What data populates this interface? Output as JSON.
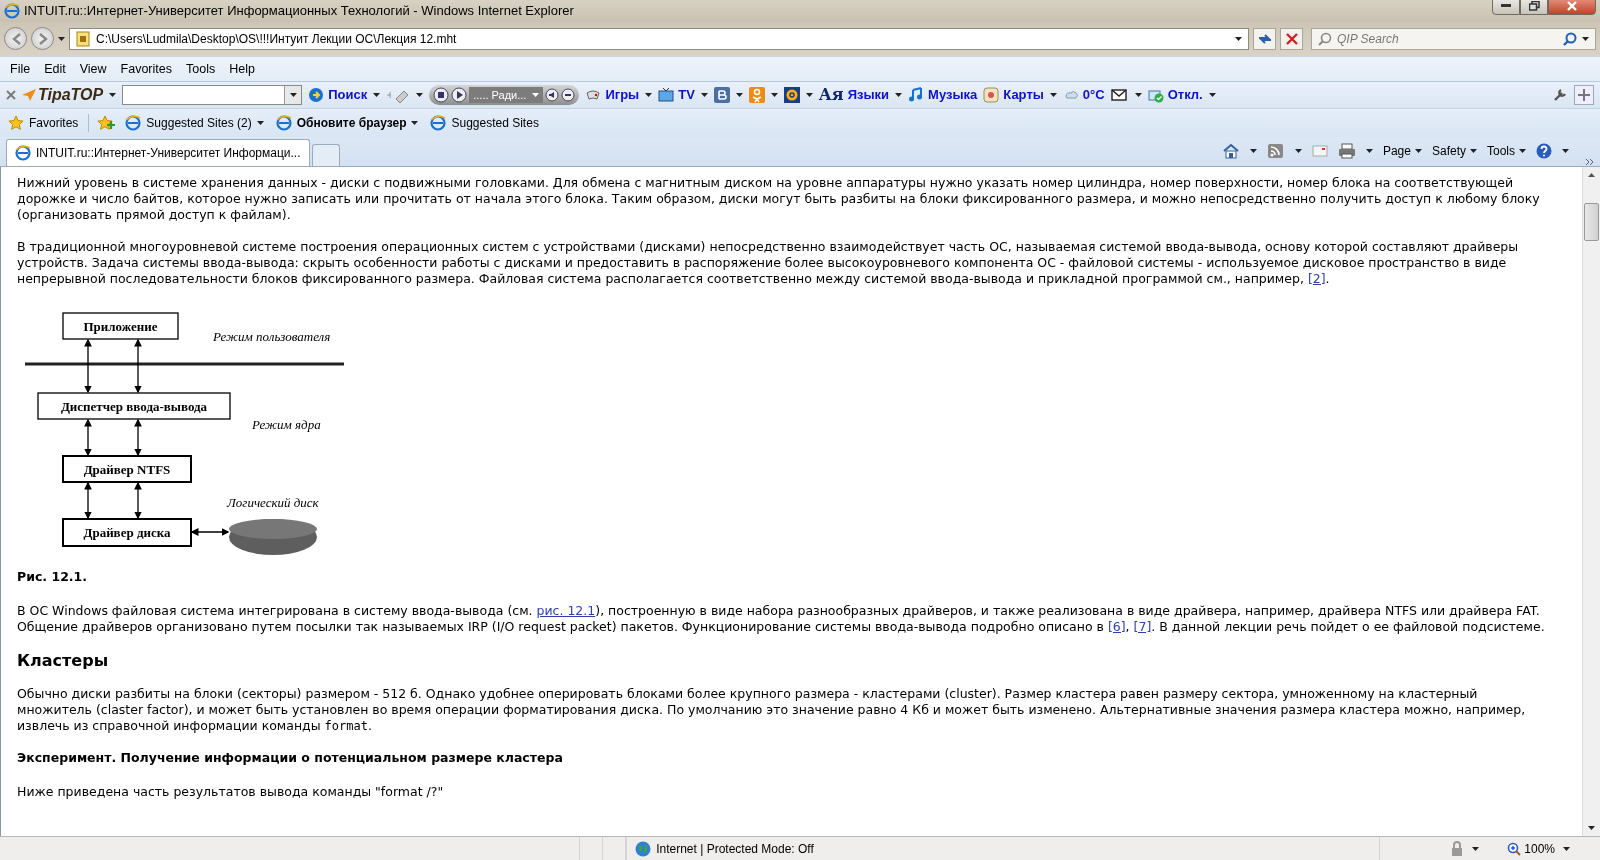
{
  "window": {
    "title": "INTUIT.ru::Интернет-Университет Информационных Технологий - Windows Internet Explorer"
  },
  "address_bar": {
    "url": "C:\\Users\\Ludmila\\Desktop\\OS\\!!!Интуит Лекции ОС\\Лекция 12.mht"
  },
  "search": {
    "placeholder": "QIP Search"
  },
  "menu": [
    "File",
    "Edit",
    "View",
    "Favorites",
    "Tools",
    "Help"
  ],
  "toolbar": {
    "logo": "TipaTOP",
    "radio": "..... Ради...",
    "glyph": "Ая",
    "items": [
      "Поиск",
      "Игры",
      "TV",
      "Языки",
      "Музыка",
      "Карты",
      "0°C",
      "Откл."
    ]
  },
  "favorites_bar": {
    "button": "Favorites",
    "items": [
      {
        "label": "Suggested Sites (2)",
        "emphasized": false,
        "dropdown": true
      },
      {
        "label": "Обновите браузер",
        "emphasized": true,
        "dropdown": true
      },
      {
        "label": "Suggested Sites",
        "emphasized": false,
        "dropdown": false
      }
    ]
  },
  "tabs": [
    {
      "title": "INTUIT.ru::Интернет-Университет Информаци...",
      "selected": true
    }
  ],
  "command_bar": [
    "Page",
    "Safety",
    "Tools"
  ],
  "content": [
    {
      "kind": "paragraph",
      "parts": [
        {
          "kind": "text",
          "text": "Нижний уровень в системе хранения данных - диски с подвижными головками. Для обмена с магнитным диском на уровне аппаратуры нужно указать номер цилиндра, номер поверхности, номер блока на соответствующей дорожке и число байтов, которое нужно записать или прочитать от начала этого блока. Таким образом, диски могут быть разбиты на блоки фиксированного размера, и можно непосредственно получить доступ к любому блоку (организовать прямой доступ к файлам)."
        }
      ]
    },
    {
      "kind": "paragraph",
      "parts": [
        {
          "kind": "text",
          "text": "В традиционной многоуровневой системе построения операционных систем с устройствами (дисками) непосредственно взаимодействует часть ОС, называемая системой ввода-вывода, основу которой составляют драйверы устройств. Задача системы ввода-вывода: скрыть особенности работы с дисками и предоставить в распоряжение более высокоуровневого компонента ОС - файловой системы - используемое дисковое пространство в виде непрерывной последовательности блоков фиксированного размера. Файловая система располагается соответственно между системой ввода-вывода и прикладной программой см., например, "
        },
        {
          "kind": "link",
          "text": "[2]"
        },
        {
          "kind": "text",
          "text": "."
        }
      ]
    },
    {
      "kind": "figure",
      "boxes": [
        "Приложение",
        "Диспетчер ввода-вывода",
        "Драйвер NTFS",
        "Драйвер диска"
      ],
      "modes": [
        "Режим пользователя",
        "Режим ядра"
      ],
      "disk_label": "Логический диск"
    },
    {
      "kind": "caption",
      "text": "Рис. 12.1."
    },
    {
      "kind": "paragraph",
      "parts": [
        {
          "kind": "text",
          "text": "В ОС Windows файловая система интегрирована в систему ввода-вывода (см. "
        },
        {
          "kind": "link",
          "text": "рис. 12.1"
        },
        {
          "kind": "text",
          "text": "), построенную в виде набора разнообразных драйверов, и также реализована в виде драйвера, например, драйвера NTFS или драйвера FAT. Общение драйверов организовано путем посылки так называемых IRP (I/O request packet) пакетов. Функционирование системы ввода-вывода подробно описано в "
        },
        {
          "kind": "link",
          "text": "[6]"
        },
        {
          "kind": "text",
          "text": ", "
        },
        {
          "kind": "link",
          "text": "[7]"
        },
        {
          "kind": "text",
          "text": ". В данной лекции речь пойдет о ее файловой подсистеме."
        }
      ]
    },
    {
      "kind": "heading",
      "text": "Кластеры"
    },
    {
      "kind": "paragraph",
      "parts": [
        {
          "kind": "text",
          "text": "Обычно диски разбиты на блоки (секторы) размером - 512 б. Однако удобнее оперировать блоками более крупного размера - кластерами (cluster). Размер кластера равен размеру сектора, умноженному на кластерный множитель (claster factor), и может быть установлен во время операции форматирования диска. По умолчанию это значение равно 4 Кб и может быть изменено. Альтернативные значения размера кластера можно, например, извлечь из справочной информации команды "
        },
        {
          "kind": "code",
          "text": "format"
        },
        {
          "kind": "text",
          "text": "."
        }
      ]
    },
    {
      "kind": "subheading",
      "text": "Эксперимент. Получение информации о потенциальном размере кластера"
    },
    {
      "kind": "paragraph",
      "parts": [
        {
          "kind": "text",
          "text": "Ниже приведена часть результатов вывода команды \"format /?\""
        }
      ]
    }
  ],
  "status_bar": {
    "zone": "Internet | Protected Mode: Off",
    "zoom": "100%"
  }
}
